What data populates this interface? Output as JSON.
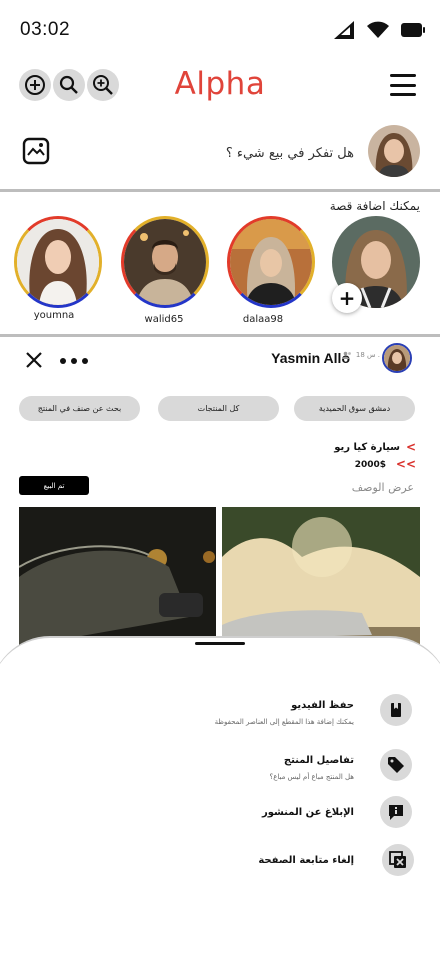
{
  "status_bar": {
    "time": "03:02"
  },
  "header": {
    "title": "Alpha",
    "colors": {
      "title": "#e0443a"
    }
  },
  "composer": {
    "prompt": "هل تفكر في بيع شيء ؟"
  },
  "stories": {
    "label": "يمكنك اضافة قصة",
    "items": [
      {
        "name": "youmna"
      },
      {
        "name": "walid65"
      },
      {
        "name": "dalaa98"
      }
    ]
  },
  "post": {
    "author": "Yasmin Allo",
    "time": "18 س .",
    "chips": [
      "دمشق سوق الحميدية",
      "كل المنتجات",
      "بحث عن صنف في المنتج"
    ],
    "product_name": "سيارة كيا ريو",
    "product_price": "2000$",
    "sold_label": "تم البيع",
    "description_link": "عرض الوصف"
  },
  "sheet": {
    "items": [
      {
        "title": "حفظ الفيديو",
        "subtitle": "يمكنك إضافة هذا المقطع إلى العناصر المحفوظة",
        "icon": "bookmark-icon"
      },
      {
        "title": "تفاصيل المنتج",
        "subtitle": "هل المنتج مباع أم ليس مباع؟",
        "icon": "tag-icon"
      },
      {
        "title": "الإبلاغ عن المنشور",
        "subtitle": "",
        "icon": "report-icon"
      },
      {
        "title": "إلغاء متابعة الصفحة",
        "subtitle": "",
        "icon": "unfollow-icon"
      }
    ]
  }
}
